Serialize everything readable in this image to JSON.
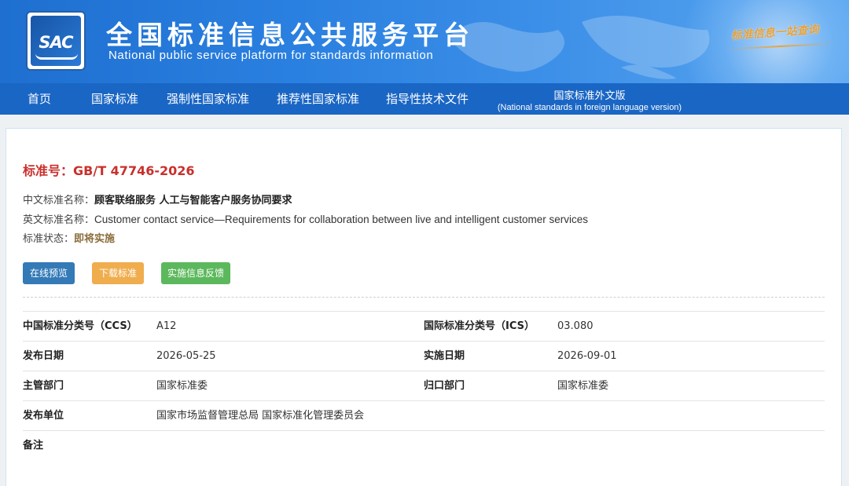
{
  "header": {
    "logo_text": "SAC",
    "title": "全国标准信息公共服务平台",
    "subtitle": "National public service platform  for standards information",
    "slogan": "标准信息一站查询"
  },
  "nav": {
    "items": [
      {
        "label": "首页"
      },
      {
        "label": "国家标准"
      },
      {
        "label": "强制性国家标准"
      },
      {
        "label": "推荐性国家标准"
      },
      {
        "label": "指导性技术文件"
      }
    ],
    "foreign": {
      "label": "国家标准外文版",
      "sub": "(National standards in foreign language version)"
    }
  },
  "standard": {
    "number_label": "标准号：",
    "number": "GB/T 47746-2026",
    "cn_name_label": "中文标准名称：",
    "cn_name": "顾客联络服务 人工与智能客户服务协同要求",
    "en_name_label": "英文标准名称：",
    "en_name": "Customer contact service—Requirements for collaboration between live and intelligent customer services",
    "status_label": "标准状态：",
    "status": "即将实施"
  },
  "buttons": {
    "preview": "在线预览",
    "download": "下载标准",
    "feedback": "实施信息反馈"
  },
  "details": {
    "ccs_label": "中国标准分类号（CCS）",
    "ccs": "A12",
    "ics_label": "国际标准分类号（ICS）",
    "ics": "03.080",
    "publish_date_label": "发布日期",
    "publish_date": "2026-05-25",
    "effective_date_label": "实施日期",
    "effective_date": "2026-09-01",
    "authority_label": "主管部门",
    "authority": "国家标准委",
    "centralized_label": "归口部门",
    "centralized": "国家标准委",
    "issuer_label": "发布单位",
    "issuer": "国家市场监督管理总局 国家标准化管理委员会",
    "remarks_label": "备注",
    "remarks": ""
  },
  "colors": {
    "banner": "#2a80e0",
    "nav": "#1a66c4",
    "std_number": "#c9302c",
    "status": "#8a6d3b",
    "btn_preview": "#337ab7",
    "btn_download": "#f0ad4e",
    "btn_feedback": "#5cb85c"
  }
}
